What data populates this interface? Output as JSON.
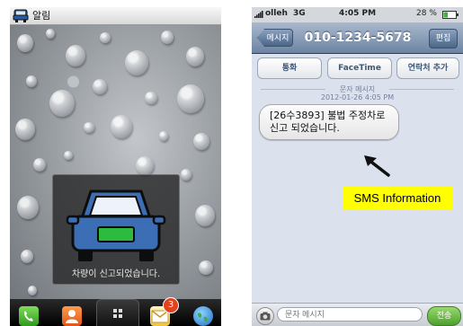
{
  "left_screen": {
    "statusbar": {
      "title": "알림",
      "icon": "car-icon"
    },
    "toast": {
      "message": "차량이 신고되었습니다.",
      "icon": "car-front-icon"
    },
    "dock": {
      "items": [
        {
          "icon": "phone-icon"
        },
        {
          "icon": "contacts-icon"
        },
        {
          "icon": "app-drawer-icon"
        },
        {
          "icon": "messages-icon",
          "badge": "3"
        },
        {
          "icon": "browser-globe-icon"
        }
      ]
    }
  },
  "right_screen": {
    "statusbar": {
      "carrier": "olleh",
      "network": "3G",
      "time": "4:05 PM",
      "battery": "28 %"
    },
    "navbar": {
      "back_label": "메시지",
      "title": "010-1234-5678",
      "edit_label": "편집"
    },
    "actions": {
      "call_label": "통화",
      "facetime_label": "FaceTime",
      "add_contact_label": "연락처 추가"
    },
    "thread": {
      "section_label": "문자 메시지",
      "timestamp": "2012-01-26 4:05 PM",
      "message_line1": "[26수3893] 불법 주정차로",
      "message_line2": "신고 되었습니다."
    },
    "annotation": {
      "label": "SMS Information",
      "highlight_color": "#ffff00"
    },
    "input": {
      "placeholder": "문자 메시지",
      "send_label": "전송"
    }
  }
}
